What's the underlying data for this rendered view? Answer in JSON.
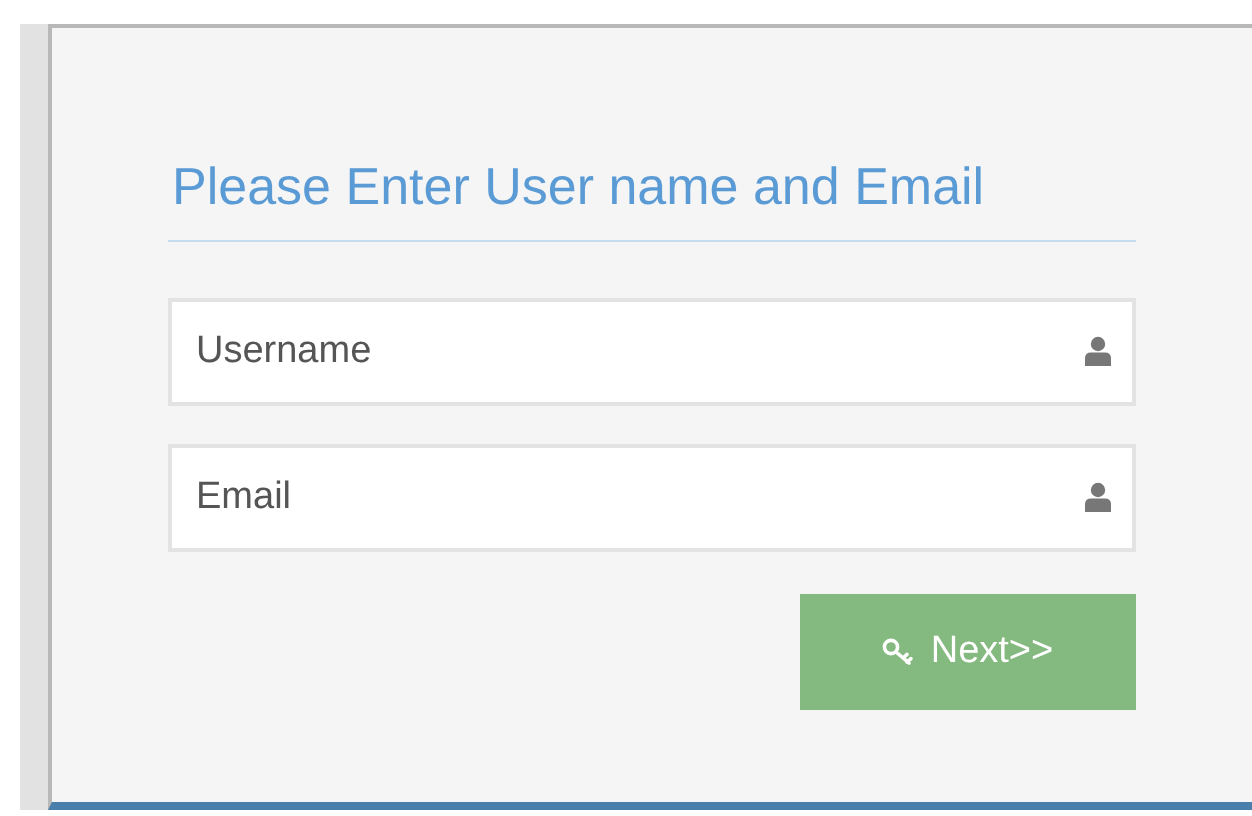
{
  "form": {
    "title": "Please Enter User name and Email",
    "fields": [
      {
        "placeholder": "Username"
      },
      {
        "placeholder": "Email"
      }
    ],
    "submit": {
      "label": "Next>>"
    }
  }
}
